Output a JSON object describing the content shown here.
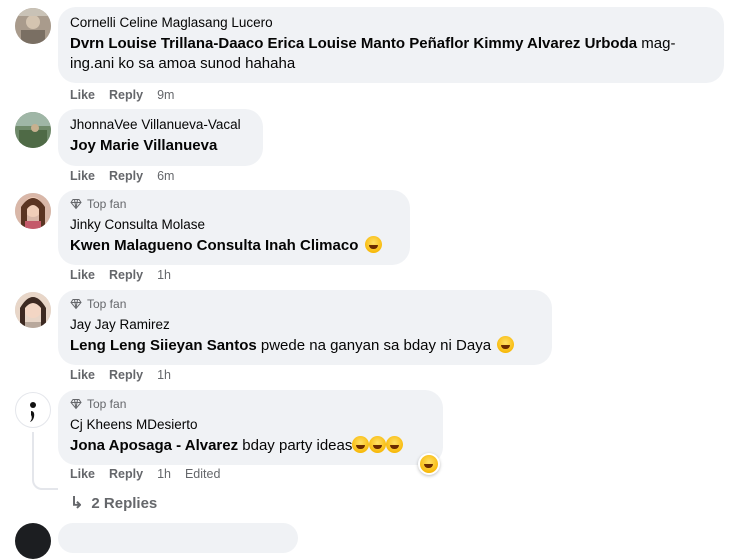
{
  "comments": [
    {
      "author": "Cornelli Celine Maglasang Lucero",
      "top_fan": false,
      "mentions": "Dvrn Louise Trillana-Daaco Erica Louise Manto Peñaflor Kimmy Alvarez Urboda",
      "line1_rest": " mag-",
      "line2": "ing.ani ko sa amoa sunod hahaha",
      "like_label": "Like",
      "reply_label": "Reply",
      "time": "9m"
    },
    {
      "author": "JhonnaVee Villanueva-Vacal",
      "top_fan": false,
      "mentions": "Joy Marie Villanueva",
      "text": "",
      "like_label": "Like",
      "reply_label": "Reply",
      "time": "6m"
    },
    {
      "author": "Jinky Consulta Molase",
      "top_fan": true,
      "top_fan_label": "Top fan",
      "mentions": "Kwen Malagueno Consulta Inah Climaco",
      "text": "",
      "emoji": "laughing-tears-emoji",
      "like_label": "Like",
      "reply_label": "Reply",
      "time": "1h"
    },
    {
      "author": "Jay Jay Ramirez",
      "top_fan": true,
      "top_fan_label": "Top fan",
      "mentions": "Leng Leng Siieyan Santos",
      "text": " pwede na ganyan sa bday ni Daya",
      "emoji": "laughing-tears-emoji",
      "like_label": "Like",
      "reply_label": "Reply",
      "time": "1h"
    },
    {
      "author": "Cj Kheens MDesierto",
      "top_fan": true,
      "top_fan_label": "Top fan",
      "mentions": "Jona Aposaga - Alvarez",
      "text": " bday party ideas",
      "emoji": "rofl-emoji",
      "like_label": "Like",
      "reply_label": "Reply",
      "time": "1h",
      "edited": "Edited",
      "reaction": "haha-reaction-icon"
    }
  ],
  "replies_link": {
    "count_label": "2 Replies"
  },
  "colors": {
    "bubble": "#f0f2f5",
    "meta": "#65676b",
    "text": "#050505"
  }
}
